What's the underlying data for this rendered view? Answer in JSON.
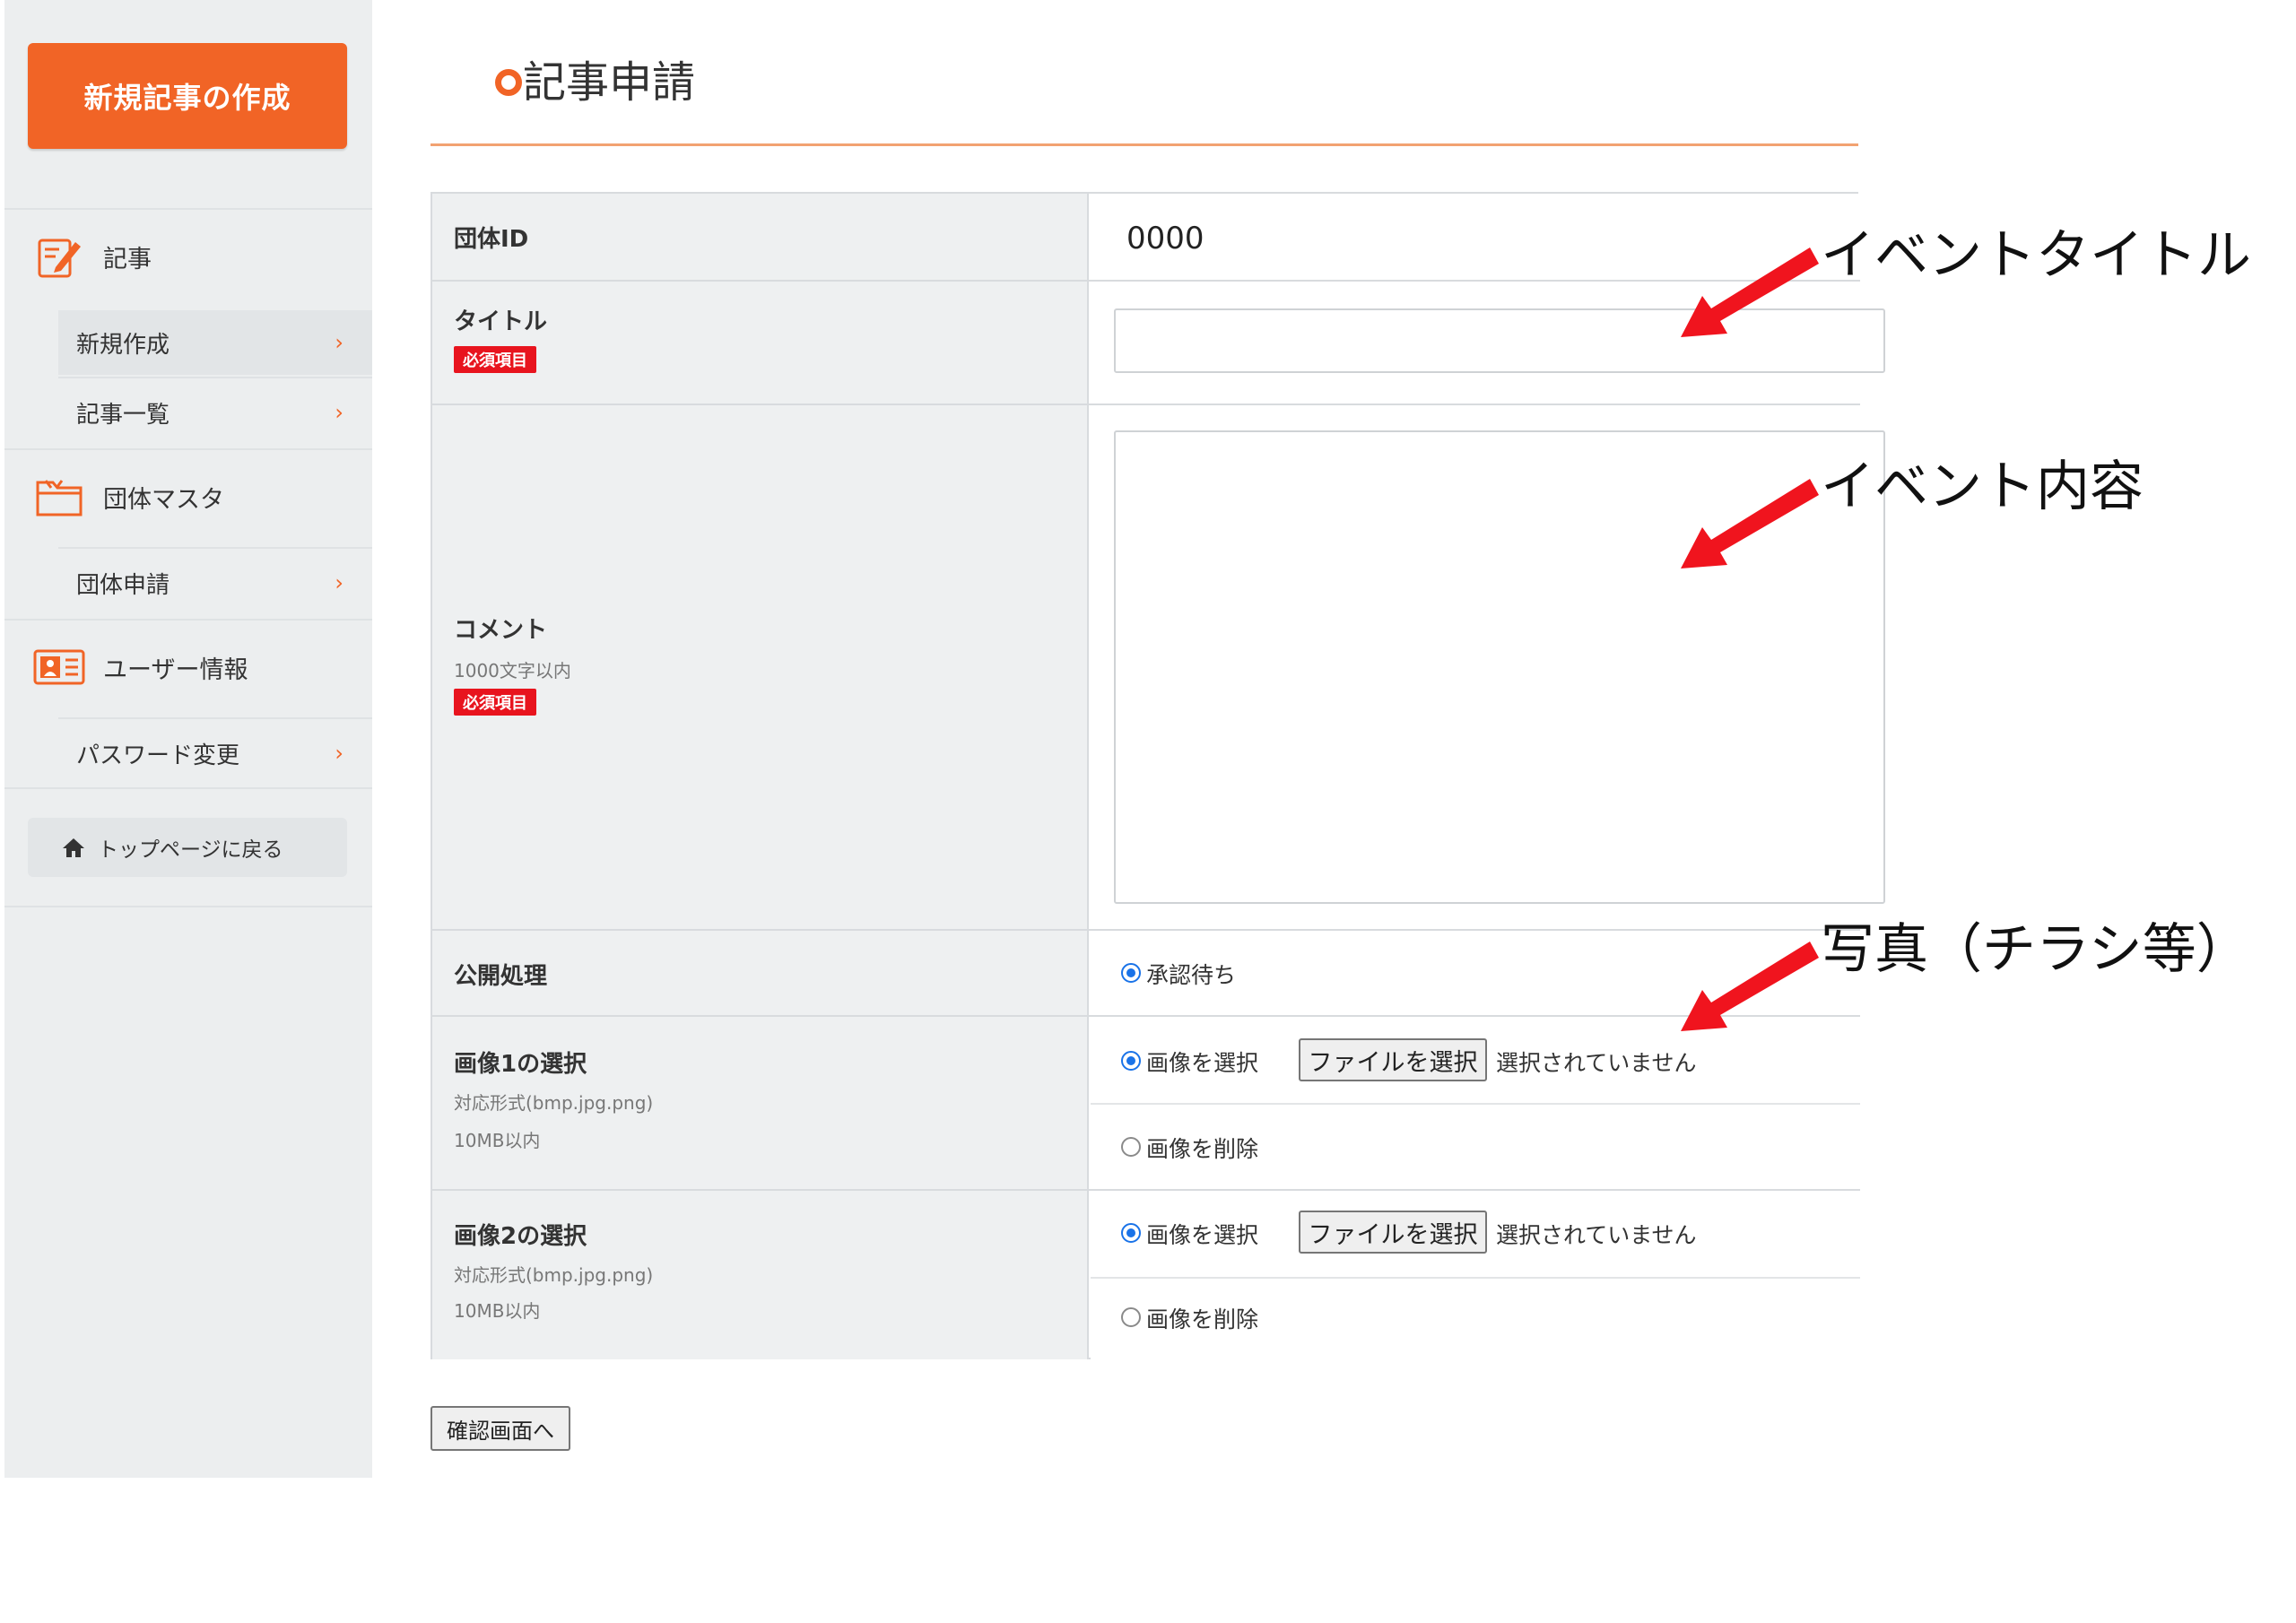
{
  "sidebar": {
    "new_post_button": "新規記事の作成",
    "sections": [
      {
        "label": "記事",
        "icon": "edit-document-icon"
      },
      {
        "label": "団体マスタ",
        "icon": "folder-icon"
      },
      {
        "label": "ユーザー情報",
        "icon": "id-card-icon"
      }
    ],
    "items": [
      {
        "label": "新規作成",
        "active": true
      },
      {
        "label": "記事一覧",
        "active": false
      },
      {
        "label": "団体申請",
        "active": false
      },
      {
        "label": "パスワード変更",
        "active": false
      }
    ],
    "chevron": "›",
    "top_page_button": "トップページに戻る"
  },
  "main": {
    "page_title": "記事申請",
    "form": {
      "group_id": {
        "label": "団体ID",
        "value": "0000"
      },
      "title": {
        "label": "タイトル",
        "required_badge": "必須項目",
        "value": ""
      },
      "comment": {
        "label": "コメント",
        "hint": "1000文字以内",
        "required_badge": "必須項目",
        "value": ""
      },
      "publish": {
        "label": "公開処理",
        "option": "承認待ち",
        "selected": true
      },
      "image1": {
        "label": "画像1の選択",
        "formats": "対応形式(bmp.jpg.png)",
        "size_limit": "10MB以内",
        "select_option": "画像を選択",
        "delete_option": "画像を削除",
        "file_button": "ファイルを選択",
        "file_status": "選択されていません"
      },
      "image2": {
        "label": "画像2の選択",
        "formats": "対応形式(bmp.jpg.png)",
        "size_limit": "10MB以内",
        "select_option": "画像を選択",
        "delete_option": "画像を削除",
        "file_button": "ファイルを選択",
        "file_status": "選択されていません"
      }
    },
    "confirm_button": "確認画面へ"
  },
  "annotations": [
    {
      "text": "イベントタイトル"
    },
    {
      "text": "イベント内容"
    },
    {
      "text": "写真（チラシ等）"
    }
  ],
  "colors": {
    "accent": "#f16426",
    "required": "#e8141e",
    "arrow": "#f0141e",
    "radio": "#1a73e8"
  }
}
